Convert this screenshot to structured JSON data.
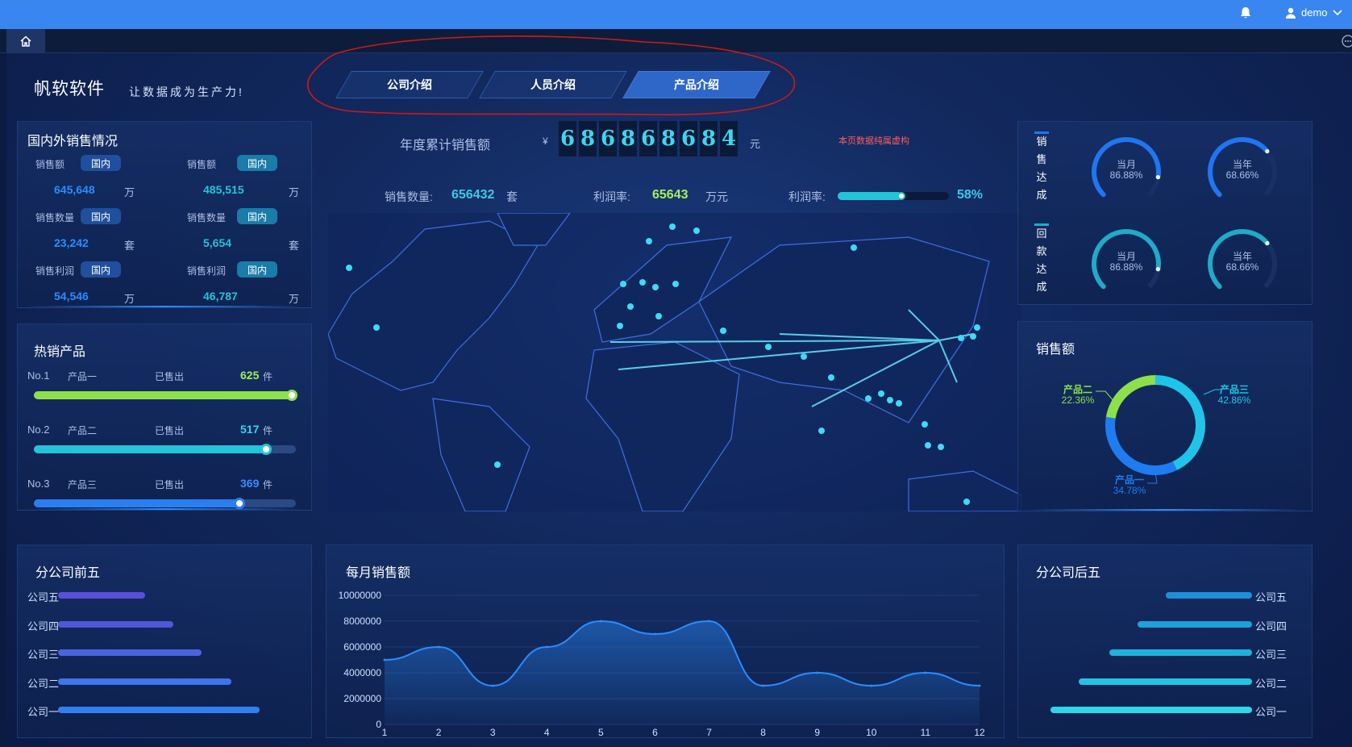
{
  "topbar": {
    "user_name": "demo"
  },
  "header": {
    "brand": "帆软软件",
    "slogan": "让数据成为生产力!"
  },
  "nav_tabs": [
    {
      "label": "公司介绍",
      "active": false
    },
    {
      "label": "人员介绍",
      "active": false
    },
    {
      "label": "产品介绍",
      "active": true
    }
  ],
  "domestic_foreign": {
    "title": "国内外销售情况",
    "badge": "国内",
    "items": [
      {
        "label": "销售额",
        "value": "645,648",
        "unit": "万",
        "col": "left"
      },
      {
        "label": "销售额",
        "value": "485,515",
        "unit": "万",
        "col": "right"
      },
      {
        "label": "销售数量",
        "value": "23,242",
        "unit": "套",
        "col": "left"
      },
      {
        "label": "销售数量",
        "value": "5,654",
        "unit": "套",
        "col": "right"
      },
      {
        "label": "销售利润",
        "value": "54,546",
        "unit": "万",
        "col": "left"
      },
      {
        "label": "销售利润",
        "value": "46,787",
        "unit": "万",
        "col": "right"
      }
    ]
  },
  "annual": {
    "label": "年度累计销售额",
    "currency": "¥",
    "digits": [
      "6",
      "8",
      "6",
      "8",
      "6",
      "8",
      "6",
      "8",
      "4"
    ],
    "unit": "元",
    "note": "本页数据纯属虚构",
    "qty_label": "销售数量:",
    "qty_value": "656432",
    "qty_unit": "套",
    "profit_label": "利润率:",
    "profit_value": "65643",
    "profit_unit": "万元",
    "rate_label": "利润率:",
    "rate_value": "58%",
    "rate_fraction": 0.58
  },
  "hot_products": {
    "title": "热销产品",
    "sold_label": "已售出",
    "unit": "件",
    "items": [
      {
        "rank": "No.1",
        "name": "产品一",
        "value": "625",
        "fraction": 1.0,
        "color": "#8de04a",
        "vcolor": "#a4f05a"
      },
      {
        "rank": "No.2",
        "name": "产品二",
        "value": "517",
        "fraction": 0.9,
        "color": "#23c4d8",
        "vcolor": "#34d4e8"
      },
      {
        "rank": "No.3",
        "name": "产品三",
        "value": "369",
        "fraction": 0.8,
        "color": "#2a7ff0",
        "vcolor": "#3d8cff"
      }
    ]
  },
  "achievement": {
    "sales_label": [
      "销",
      "售",
      "达",
      "成"
    ],
    "payback_label": [
      "回",
      "款",
      "达",
      "成"
    ],
    "gauges": [
      {
        "label": "当月",
        "value": "86.88%",
        "fraction": 0.8688,
        "color": "#1f76f0",
        "group": "sales",
        "pos": "left"
      },
      {
        "label": "当年",
        "value": "68.66%",
        "fraction": 0.6866,
        "color": "#1f76f0",
        "group": "sales",
        "pos": "right"
      },
      {
        "label": "当月",
        "value": "86.88%",
        "fraction": 0.8688,
        "color": "#21a9c8",
        "group": "payback",
        "pos": "left"
      },
      {
        "label": "当年",
        "value": "68.66%",
        "fraction": 0.6866,
        "color": "#21a9c8",
        "group": "payback",
        "pos": "right"
      }
    ]
  },
  "sales_donut": {
    "title": "销售额",
    "slices": [
      {
        "name": "产品三",
        "value": "42.86%",
        "color": "#1fc5e8"
      },
      {
        "name": "产品一",
        "value": "34.78%",
        "color": "#1f7cf0"
      },
      {
        "name": "产品二",
        "value": "22.36%",
        "color": "#8de04a"
      }
    ]
  },
  "top_five": {
    "title": "分公司前五",
    "items": [
      {
        "name": "公司五",
        "fraction": 0.43
      },
      {
        "name": "公司四",
        "fraction": 0.57
      },
      {
        "name": "公司三",
        "fraction": 0.71
      },
      {
        "name": "公司二",
        "fraction": 0.86
      },
      {
        "name": "公司一",
        "fraction": 1.0
      }
    ]
  },
  "bottom_five": {
    "title": "分公司后五",
    "items": [
      {
        "name": "公司五",
        "fraction": 0.43
      },
      {
        "name": "公司四",
        "fraction": 0.57
      },
      {
        "name": "公司三",
        "fraction": 0.71
      },
      {
        "name": "公司二",
        "fraction": 0.86
      },
      {
        "name": "公司一",
        "fraction": 1.0
      }
    ]
  },
  "chart_data": {
    "type": "area",
    "title": "每月销售额",
    "x": [
      1,
      2,
      3,
      4,
      5,
      6,
      7,
      8,
      9,
      10,
      11,
      12
    ],
    "values": [
      5000000,
      6000000,
      3000000,
      6000000,
      8000000,
      7000000,
      8000000,
      3000000,
      4000000,
      3000000,
      4000000,
      3000000
    ],
    "ylim": [
      0,
      10000000
    ],
    "yticks": [
      "0",
      "2000000",
      "4000000",
      "6000000",
      "8000000",
      "10000000"
    ],
    "grid": true,
    "color": "#2a8cff"
  }
}
